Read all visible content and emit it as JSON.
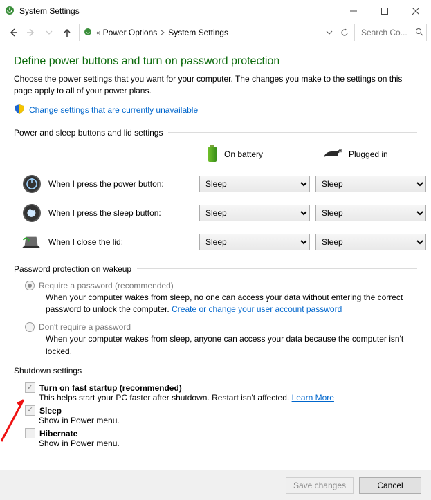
{
  "window": {
    "title": "System Settings"
  },
  "breadcrumb": {
    "seg1": "Power Options",
    "seg2": "System Settings"
  },
  "search": {
    "placeholder": "Search Co..."
  },
  "page": {
    "title": "Define power buttons and turn on password protection",
    "sub": "Choose the power settings that you want for your computer. The changes you make to the settings on this page apply to all of your power plans.",
    "change_unavailable": "Change settings that are currently unavailable"
  },
  "sec_buttons": {
    "heading": "Power and sleep buttons and lid settings",
    "col_battery": "On battery",
    "col_plugged": "Plugged in",
    "row_power": "When I press the power button:",
    "row_sleep": "When I press the sleep button:",
    "row_lid": "When I close the lid:",
    "opt_sleep": "Sleep",
    "values": {
      "power_bat": "Sleep",
      "power_ac": "Sleep",
      "sleep_bat": "Sleep",
      "sleep_ac": "Sleep",
      "lid_bat": "Sleep",
      "lid_ac": "Sleep"
    }
  },
  "sec_password": {
    "heading": "Password protection on wakeup",
    "opt1_label": "Require a password (recommended)",
    "opt1_desc_a": "When your computer wakes from sleep, no one can access your data without entering the correct password to unlock the computer. ",
    "opt1_link": "Create or change your user account password",
    "opt2_label": "Don't require a password",
    "opt2_desc": "When your computer wakes from sleep, anyone can access your data because the computer isn't locked."
  },
  "sec_shutdown": {
    "heading": "Shutdown settings",
    "fast_label": "Turn on fast startup (recommended)",
    "fast_desc_a": "This helps start your PC faster after shutdown. Restart isn't affected. ",
    "fast_link": "Learn More",
    "sleep_label": "Sleep",
    "sleep_desc": "Show in Power menu.",
    "hibernate_label": "Hibernate",
    "hibernate_desc": "Show in Power menu."
  },
  "footer": {
    "save": "Save changes",
    "cancel": "Cancel"
  }
}
